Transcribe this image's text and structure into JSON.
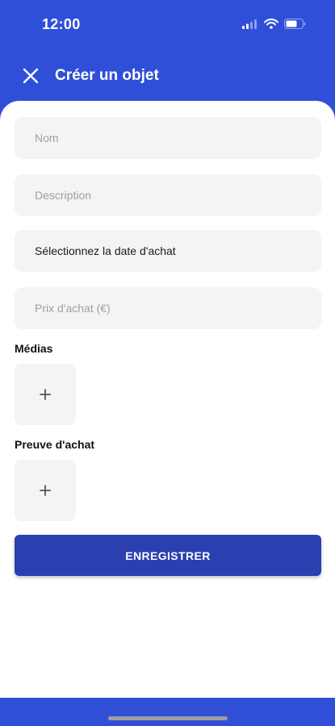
{
  "status_bar": {
    "time": "12:00",
    "icons": [
      "signal-icon",
      "wifi-icon",
      "battery-icon"
    ]
  },
  "header": {
    "close_icon": "close-icon",
    "title": "Créer un objet"
  },
  "form": {
    "name_placeholder": "Nom",
    "description_placeholder": "Description",
    "purchase_date_label": "Sélectionnez la date d'achat",
    "purchase_price_placeholder": "Prix d'achat (€)",
    "media_label": "Médias",
    "media_add_symbol": "+",
    "proof_label": "Preuve d'achat",
    "proof_add_symbol": "+",
    "save_label": "ENREGISTRER"
  },
  "colors": {
    "primary": "#2f4fd8",
    "button": "#2a3fb0",
    "field_bg": "#f4f4f4"
  }
}
